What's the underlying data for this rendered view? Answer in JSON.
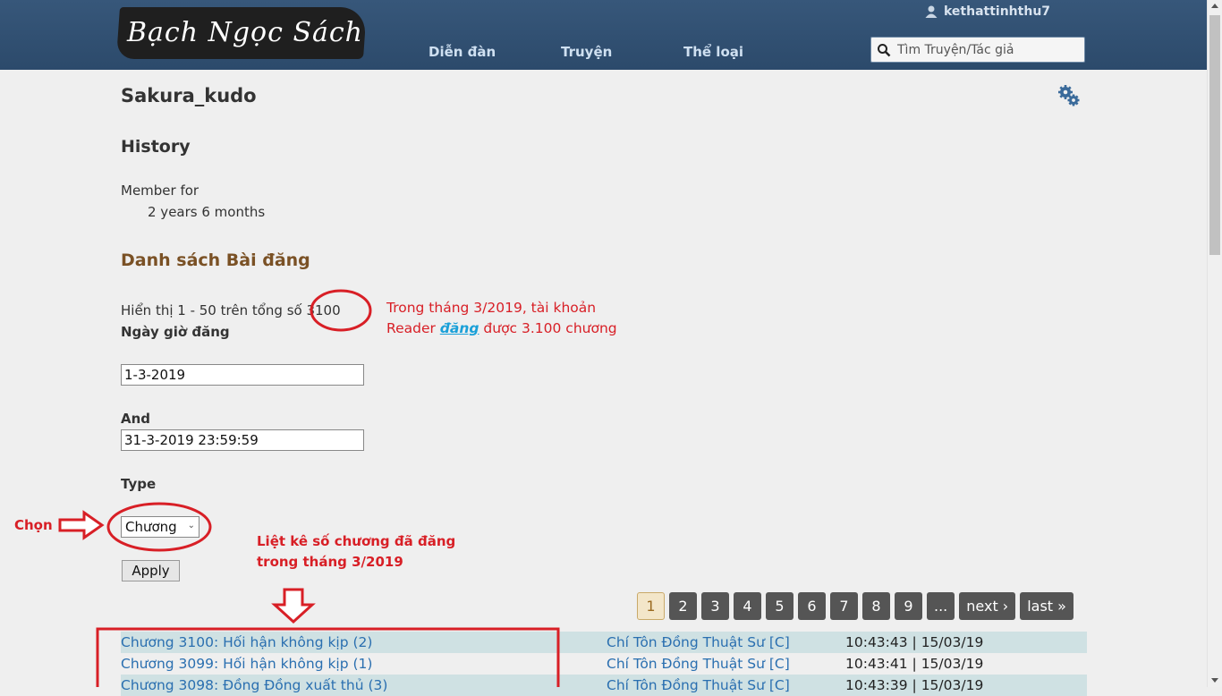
{
  "header": {
    "logo_text": "Bạch Ngọc Sách",
    "nav": [
      "Diễn đàn",
      "Truyện",
      "Thể loại"
    ],
    "username": "kethattinhthu7",
    "search_placeholder": "Tìm Truyện/Tác giả"
  },
  "profile": {
    "name": "Sakura_kudo",
    "history_heading": "History",
    "member_for_label": "Member for",
    "member_for_value": "2 years 6 months"
  },
  "posts": {
    "heading": "Danh sách Bài đăng",
    "showing_prefix": "Hiển thị 1 - 50 trên tổng số ",
    "total": "3100",
    "date_label": "Ngày giờ đăng",
    "date_from": "1-3-2019",
    "and_label": "And",
    "date_to": "31-3-2019 23:59:59",
    "type_label": "Type",
    "type_value": "Chương",
    "apply_label": "Apply"
  },
  "pager": {
    "pages": [
      "1",
      "2",
      "3",
      "4",
      "5",
      "6",
      "7",
      "8",
      "9",
      "..."
    ],
    "next": "next ›",
    "last": "last »"
  },
  "rows": [
    {
      "title": "Chương 3100: Hối hận không kịp (2)",
      "story": "Chí Tôn Đồng Thuật Sư [C]",
      "time": "10:43:43 | 15/03/19"
    },
    {
      "title": "Chương 3099: Hối hận không kịp (1)",
      "story": "Chí Tôn Đồng Thuật Sư [C]",
      "time": "10:43:41 | 15/03/19"
    },
    {
      "title": "Chương 3098: Đồng Đồng xuất thủ (3)",
      "story": "Chí Tôn Đồng Thuật Sư [C]",
      "time": "10:43:39 | 15/03/19"
    }
  ],
  "annotations": {
    "note1_line1": "Trong tháng 3/2019, tài khoản",
    "note1_line2_prefix": "Reader ",
    "note1_line2_em": "đăng",
    "note1_line2_suffix": " được 3.100 chương",
    "note2_line1": "Liệt kê số chương đã đăng",
    "note2_line2": "trong tháng 3/2019",
    "chon": "Chọn",
    "color": "#d81f26"
  }
}
